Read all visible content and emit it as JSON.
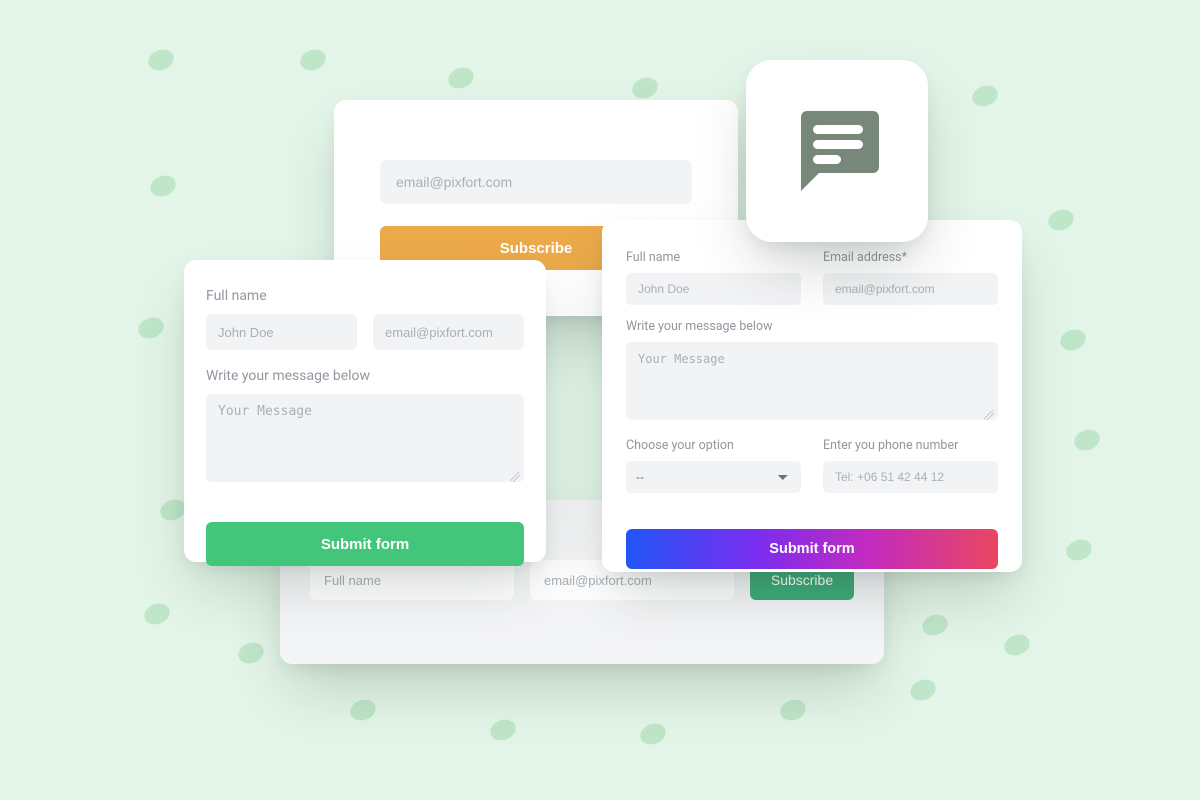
{
  "subscribe_top": {
    "email_placeholder": "email@pixfort.com",
    "button_label": "Subscribe"
  },
  "left_form": {
    "fullname_label": "Full name",
    "fullname_placeholder": "John Doe",
    "email_placeholder": "email@pixfort.com",
    "message_label": "Write your message below",
    "message_placeholder": "Your Message",
    "submit_label": "Submit form"
  },
  "bottom_subscribe": {
    "fullname_placeholder": "Full name",
    "email_placeholder": "email@pixfort.com",
    "subscribe_label": "Subscribe"
  },
  "right_form": {
    "fullname_label": "Full name",
    "fullname_placeholder": "John Doe",
    "email_label": "Email address*",
    "email_placeholder": "email@pixfort.com",
    "message_label": "Write your message below",
    "message_placeholder": "Your Message",
    "option_label": "Choose your option",
    "option_selected": "--",
    "phone_label": "Enter you phone number",
    "phone_placeholder": "Tel: +06 51 42 44 12",
    "submit_label": "Submit form"
  },
  "colors": {
    "bg": "#e3f5e8",
    "dot": "#bfe6c9",
    "orange": "#eba94a",
    "green": "#43c57a",
    "green_dark": "#3eab78",
    "gradient_from": "#2156f5",
    "gradient_to": "#ea4660",
    "icon_fill": "#77887b"
  }
}
